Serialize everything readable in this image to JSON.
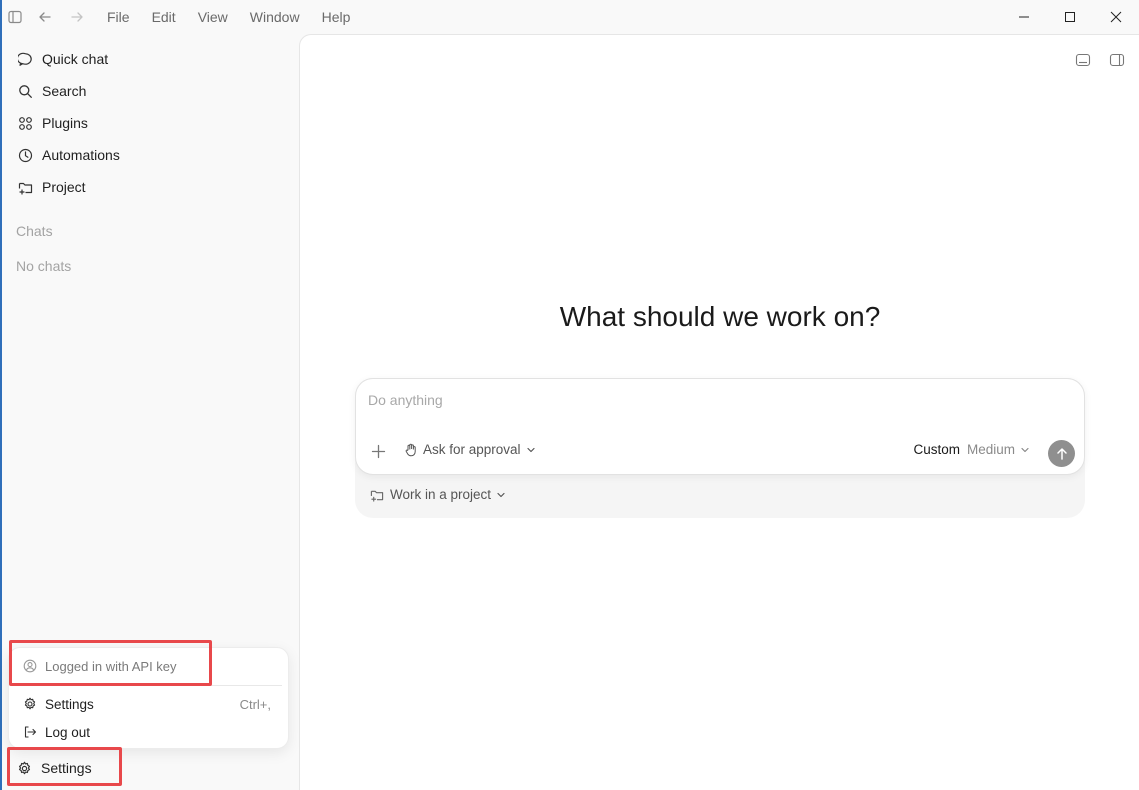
{
  "titlebar": {
    "menu": [
      "File",
      "Edit",
      "View",
      "Window",
      "Help"
    ]
  },
  "sidebar": {
    "items": [
      {
        "label": "Quick chat",
        "icon": "chat-bubble-icon"
      },
      {
        "label": "Search",
        "icon": "search-icon"
      },
      {
        "label": "Plugins",
        "icon": "plugins-grid-icon"
      },
      {
        "label": "Automations",
        "icon": "clock-icon"
      },
      {
        "label": "Project",
        "icon": "folder-plus-icon"
      }
    ],
    "chats_label": "Chats",
    "no_chats": "No chats"
  },
  "popup": {
    "account": "Logged in with API key",
    "settings": "Settings",
    "settings_shortcut": "Ctrl+,",
    "logout": "Log out"
  },
  "settings_button": "Settings",
  "main": {
    "heading": "What should we work on?",
    "composer": {
      "placeholder": "Do anything",
      "approval": "Ask for approval",
      "model_name": "Custom",
      "model_effort": "Medium",
      "project": "Work in a project"
    }
  },
  "colors": {
    "highlight": "#e8484b",
    "send_button": "#8f8f8f"
  }
}
